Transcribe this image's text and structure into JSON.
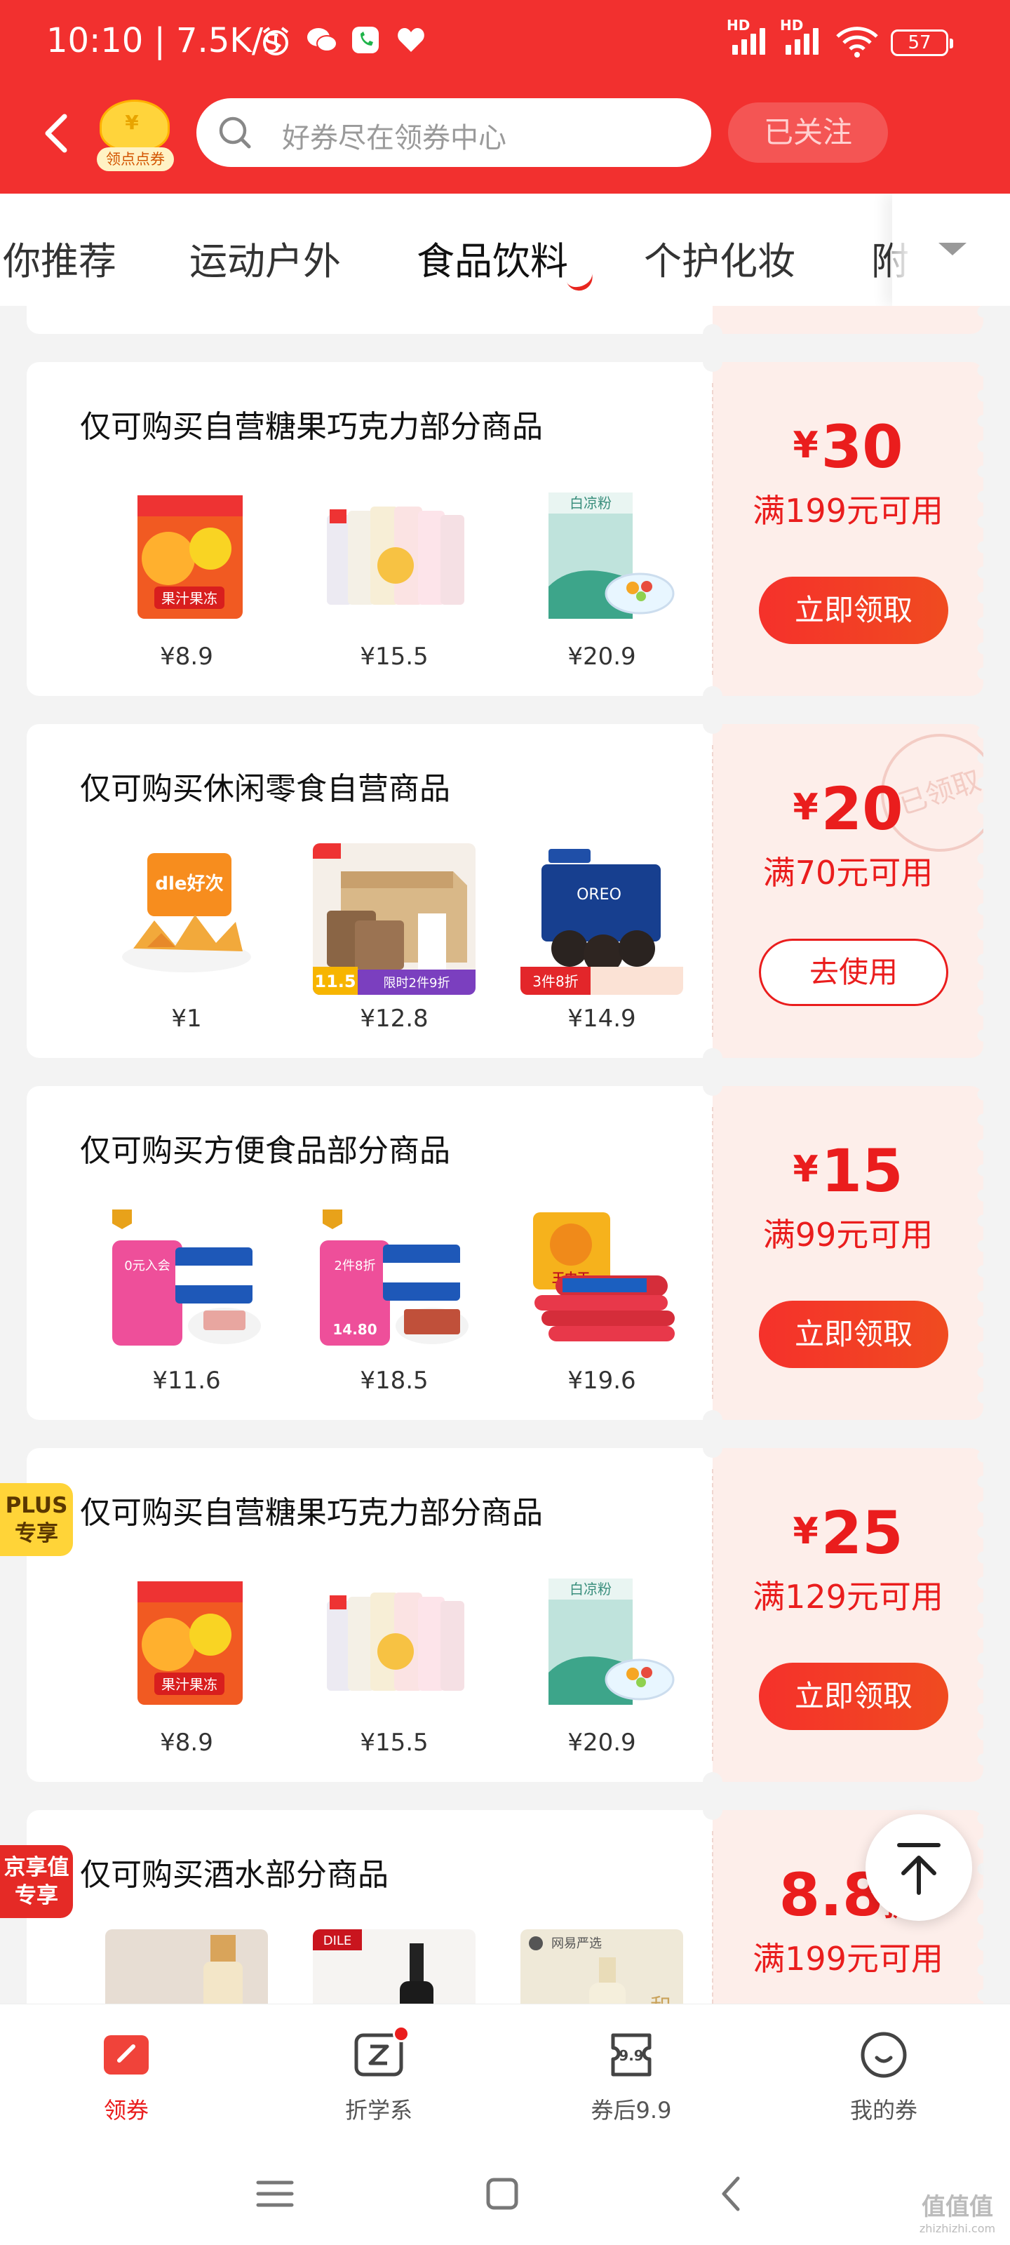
{
  "status_bar": {
    "time": "10:10",
    "speed": "7.5K/s",
    "battery": "57",
    "hd1": "HD",
    "hd2": "HD"
  },
  "header": {
    "logo_label": "领点点券",
    "search_placeholder": "好券尽在领券中心",
    "follow_label": "已关注"
  },
  "tabs": [
    "你推荐",
    "运动户外",
    "食品饮料",
    "个护化妆",
    "附"
  ],
  "active_tab": "食品饮料",
  "coupons": [
    {
      "title": "仅可购买自营糖果巧克力部分商品",
      "currency": "¥",
      "amount": "30",
      "condition": "满199元可用",
      "button": "立即领取",
      "button_style": "filled",
      "products": [
        {
          "price": "¥8.9",
          "art": "candy-bag"
        },
        {
          "price": "¥15.5",
          "art": "jelly-pouches"
        },
        {
          "price": "¥20.9",
          "art": "jelly-powder"
        }
      ]
    },
    {
      "title": "仅可购买休闲零食自营商品",
      "currency": "¥",
      "amount": "20",
      "condition": "满70元可用",
      "button": "去使用",
      "button_style": "outline",
      "stamp": "已领取",
      "products": [
        {
          "price": "¥1",
          "art": "snack-chips",
          "caption": "dle好次"
        },
        {
          "price": "¥12.8",
          "art": "bread-box",
          "badge": "11.5",
          "caption": "限时2件9折"
        },
        {
          "price": "¥14.9",
          "art": "oreo",
          "caption": "3件8折"
        }
      ]
    },
    {
      "title": "仅可购买方便食品部分商品",
      "currency": "¥",
      "amount": "15",
      "condition": "满99元可用",
      "button": "立即领取",
      "button_style": "filled",
      "products": [
        {
          "price": "¥11.6",
          "art": "canned-meat",
          "caption": "0元入会"
        },
        {
          "price": "¥18.5",
          "art": "canned-meat-2",
          "caption": "2件8折",
          "badge": "14.80"
        },
        {
          "price": "¥19.6",
          "art": "sausages",
          "caption": "王中王"
        }
      ]
    },
    {
      "title": "仅可购买自营糖果巧克力部分商品",
      "currency": "¥",
      "amount": "25",
      "condition": "满129元可用",
      "button": "立即领取",
      "button_style": "filled",
      "tag": {
        "style": "plus",
        "line1": "PLUS",
        "line2": "专享"
      },
      "products": [
        {
          "price": "¥8.9",
          "art": "candy-bag"
        },
        {
          "price": "¥15.5",
          "art": "jelly-pouches"
        },
        {
          "price": "¥20.9",
          "art": "jelly-powder"
        }
      ]
    },
    {
      "title": "仅可购买酒水部分商品",
      "currency": "",
      "amount": "8.8",
      "unit": "折",
      "condition": "满199元可用",
      "button": "",
      "button_style": "none",
      "tag": {
        "style": "jx",
        "line1": "京享值",
        "line2": "专享"
      },
      "products": [
        {
          "price": "",
          "art": "drink-bottle"
        },
        {
          "price": "",
          "art": "wine-bottle",
          "caption": "DILE"
        },
        {
          "price": "",
          "art": "sake-bottle",
          "caption": "网易严选"
        }
      ]
    }
  ],
  "bottom_nav": [
    {
      "label": "领券",
      "icon": "coupon-icon",
      "active": true
    },
    {
      "label": "折学系",
      "icon": "zhe-icon",
      "active": false
    },
    {
      "label": "券后9.9",
      "icon": "tag-99-icon",
      "active": false,
      "icon_text": "9.9"
    },
    {
      "label": "我的券",
      "icon": "smile-icon",
      "active": false
    }
  ],
  "watermark": {
    "text": "值值值",
    "sub": "zhizhizhi.com"
  },
  "colors": {
    "brand_red": "#f2302f",
    "accent_red": "#ea1d1d",
    "coupon_bg": "#fdeeea"
  }
}
